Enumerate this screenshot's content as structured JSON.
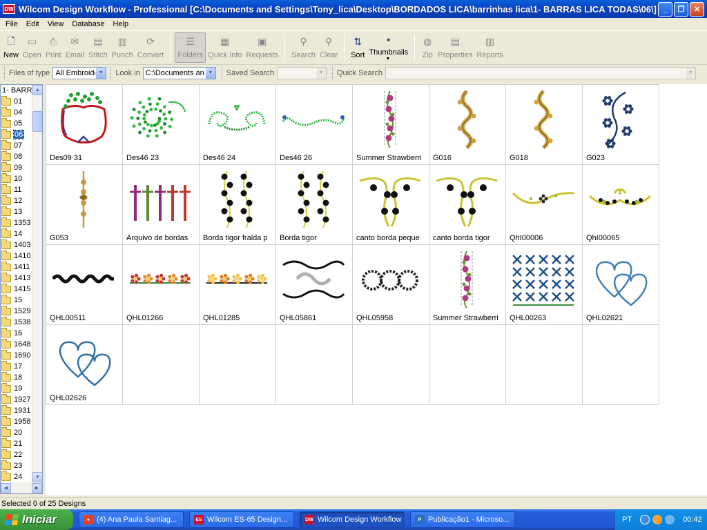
{
  "window": {
    "app_icon": "DW",
    "title": "Wilcom Design Workflow - Professional  [C:\\Documents and Settings\\Tony_lica\\Desktop\\BORDADOS LICA\\barrinhas lica\\1- BARRAS LICA TODAS\\06\\]",
    "buttons": {
      "minimize": "_",
      "maximize": "❐",
      "close": "✕"
    }
  },
  "menu": [
    "File",
    "Edit",
    "View",
    "Database",
    "Help"
  ],
  "toolbar": {
    "items": [
      {
        "label": "New",
        "icon": "new-icon",
        "glyph": "🗋",
        "state": "enabled"
      },
      {
        "label": "Open",
        "icon": "open-icon",
        "glyph": "▭",
        "state": "disabled"
      },
      {
        "label": "Print",
        "icon": "print-icon",
        "glyph": "⎙",
        "state": "disabled"
      },
      {
        "label": "Email",
        "icon": "email-icon",
        "glyph": "✉",
        "state": "disabled"
      },
      {
        "label": "Stitch",
        "icon": "stitch-icon",
        "glyph": "▤",
        "state": "disabled"
      },
      {
        "label": "Punch",
        "icon": "punch-icon",
        "glyph": "▥",
        "state": "disabled"
      },
      {
        "label": "Convert",
        "icon": "convert-icon",
        "glyph": "⟳",
        "state": "disabled"
      },
      {
        "label": "Folders",
        "icon": "folders-icon",
        "glyph": "☰",
        "state": "active"
      },
      {
        "label": "Quick Info",
        "icon": "quick-info-icon",
        "glyph": "▦",
        "state": "disabled"
      },
      {
        "label": "Requests",
        "icon": "requests-icon",
        "glyph": "▣",
        "state": "disabled"
      },
      {
        "label": "Search",
        "icon": "search-icon",
        "glyph": "⚲",
        "state": "disabled"
      },
      {
        "label": "Clear",
        "icon": "clear-icon",
        "glyph": "⚲",
        "state": "disabled"
      },
      {
        "label": "Sort",
        "icon": "sort-icon",
        "glyph": "⇅",
        "state": "enabled"
      },
      {
        "label": "Thumbnails",
        "icon": "thumbnails-icon",
        "glyph": "▪",
        "state": "enabled"
      },
      {
        "label": "Zip",
        "icon": "zip-icon",
        "glyph": "◍",
        "state": "disabled"
      },
      {
        "label": "Properties",
        "icon": "properties-icon",
        "glyph": "▤",
        "state": "disabled"
      },
      {
        "label": "Reports",
        "icon": "reports-icon",
        "glyph": "▥",
        "state": "disabled"
      }
    ]
  },
  "search": {
    "files_of_type_label": "Files of type",
    "files_of_type_value": "All Embroide",
    "look_in_label": "Look in",
    "look_in_value": "C:\\Documents an",
    "saved_search_label": "Saved Search",
    "saved_search_value": "",
    "quick_search_label": "Quick Search",
    "quick_search_value": ""
  },
  "tree": {
    "root": "1- BARR",
    "selected": "06",
    "items": [
      "01",
      "04",
      "05",
      "06",
      "07",
      "08",
      "09",
      "10",
      "11",
      "12",
      "13",
      "1353",
      "14",
      "1403",
      "1410",
      "1411",
      "1413",
      "1415",
      "15",
      "1529",
      "1538",
      "16",
      "1648",
      "1690",
      "17",
      "18",
      "19",
      "1927",
      "1931",
      "1958",
      "20",
      "21",
      "22",
      "23",
      "24"
    ]
  },
  "designs": [
    {
      "name": "Des09 31",
      "art": "wreath",
      "c1": "#1FA22E",
      "c2": "#C4161C",
      "c3": "#2F3C9E"
    },
    {
      "name": "Des46 23",
      "art": "swirl",
      "c1": "#2DB83D",
      "c2": "#1C8A2B",
      "c3": "#2DB83D"
    },
    {
      "name": "Des46 24",
      "art": "scroll",
      "c1": "#2DB83D",
      "c2": "#1C8A2B",
      "c3": "#2DB83D"
    },
    {
      "name": "Des46 26",
      "art": "wave",
      "c1": "#2DB83D",
      "c2": "#1C8A2B",
      "c3": "#2DB83D"
    },
    {
      "name": "Summer Strawberri",
      "art": "vine",
      "c1": "#B23A7A",
      "c2": "#6F8F3A",
      "c3": "#C9C9C9"
    },
    {
      "name": "G016",
      "art": "ornament",
      "c1": "#C9A24A",
      "c2": "#8C6A23",
      "c3": "#C9A24A"
    },
    {
      "name": "G018",
      "art": "ornament",
      "c1": "#D1A540",
      "c2": "#7E6021",
      "c3": "#D1A540"
    },
    {
      "name": "G023",
      "art": "floral",
      "c1": "#1E3C6E",
      "c2": "#1E3C6E",
      "c3": "#1E3C6E"
    },
    {
      "name": "G053",
      "art": "chain",
      "c1": "#C79A44",
      "c2": "#8C6A23",
      "c3": "#C79A44"
    },
    {
      "name": "Arquivo de bordas",
      "art": "crosses",
      "c1": "#8E2B7C",
      "c2": "#5C8A2F",
      "c3": "#C0392B"
    },
    {
      "name": "Borda tigor fralda p",
      "art": "double-vine",
      "c1": "#111111",
      "c2": "#D6D23B",
      "c3": "#111111"
    },
    {
      "name": "Borda tigor",
      "art": "double-vine",
      "c1": "#111111",
      "c2": "#D6D23B",
      "c3": "#111111"
    },
    {
      "name": "canto borda peque",
      "art": "corner",
      "c1": "#C9C22E",
      "c2": "#111111",
      "c3": "#C9C22E"
    },
    {
      "name": "canto borda tigor",
      "art": "corner",
      "c1": "#C9C22E",
      "c2": "#111111",
      "c3": "#C9C22E"
    },
    {
      "name": "QhI00006",
      "art": "garland",
      "c1": "#C9C22E",
      "c2": "#2C2C2C",
      "c3": "#9FB43A"
    },
    {
      "name": "QhI00065",
      "art": "bow-garland",
      "c1": "#C9C22E",
      "c2": "#111111",
      "c3": "#9FB43A"
    },
    {
      "name": "QHL00511",
      "art": "strip",
      "c1": "#111111",
      "c2": "#111111",
      "c3": "#111111"
    },
    {
      "name": "QHL01266",
      "art": "flower-row",
      "c1": "#E08A2A",
      "c2": "#2D8A3A",
      "c3": "#C0392B"
    },
    {
      "name": "QHL01285",
      "art": "flower-row",
      "c1": "#E07A1F",
      "c2": "#222222",
      "c3": "#F2C14E"
    },
    {
      "name": "QHL05861",
      "art": "lace",
      "c1": "#111111",
      "c2": "#B0B0B0",
      "c3": "#111111"
    },
    {
      "name": "QHL05958",
      "art": "rings",
      "c1": "#222222",
      "c2": "#E7E7E7",
      "c3": "#222222"
    },
    {
      "name": "Summer Strawberri",
      "art": "vine",
      "c1": "#B23A7A",
      "c2": "#6F8F3A",
      "c3": "#C9C9C9"
    },
    {
      "name": "QHL00263",
      "art": "lattice",
      "c1": "#1C4F86",
      "c2": "#3E8E3E",
      "c3": "#1C4F86"
    },
    {
      "name": "QHL02621",
      "art": "hearts",
      "c1": "#3F7FB5",
      "c2": "#3F7FB5",
      "c3": "#3F7FB5"
    },
    {
      "name": "QHL02626",
      "art": "hearts",
      "c1": "#2E6FA6",
      "c2": "#2E6FA6",
      "c3": "#2E6FA6"
    }
  ],
  "grid_total_cells": 32,
  "status": "Selected 0 of 25 Designs",
  "taskbar": {
    "start_label": "Iniciar",
    "tasks": [
      {
        "label": "(4) Ana Paula Santiag...",
        "icon": "chrome-icon",
        "color": "#E2412B",
        "glyph": "●",
        "active": false
      },
      {
        "label": "Wilcom ES-65 Design...",
        "icon": "wilcom-es-icon",
        "color": "#C8102E",
        "glyph": "ES",
        "active": false
      },
      {
        "label": "Wilcom Design Workflow",
        "icon": "wilcom-dw-icon",
        "color": "#C8102E",
        "glyph": "DW",
        "active": true
      },
      {
        "label": "Publicação1 - Microso...",
        "icon": "publisher-icon",
        "color": "#2A6FBF",
        "glyph": "P",
        "active": false
      }
    ],
    "language": "PT",
    "clock": "00:42"
  }
}
